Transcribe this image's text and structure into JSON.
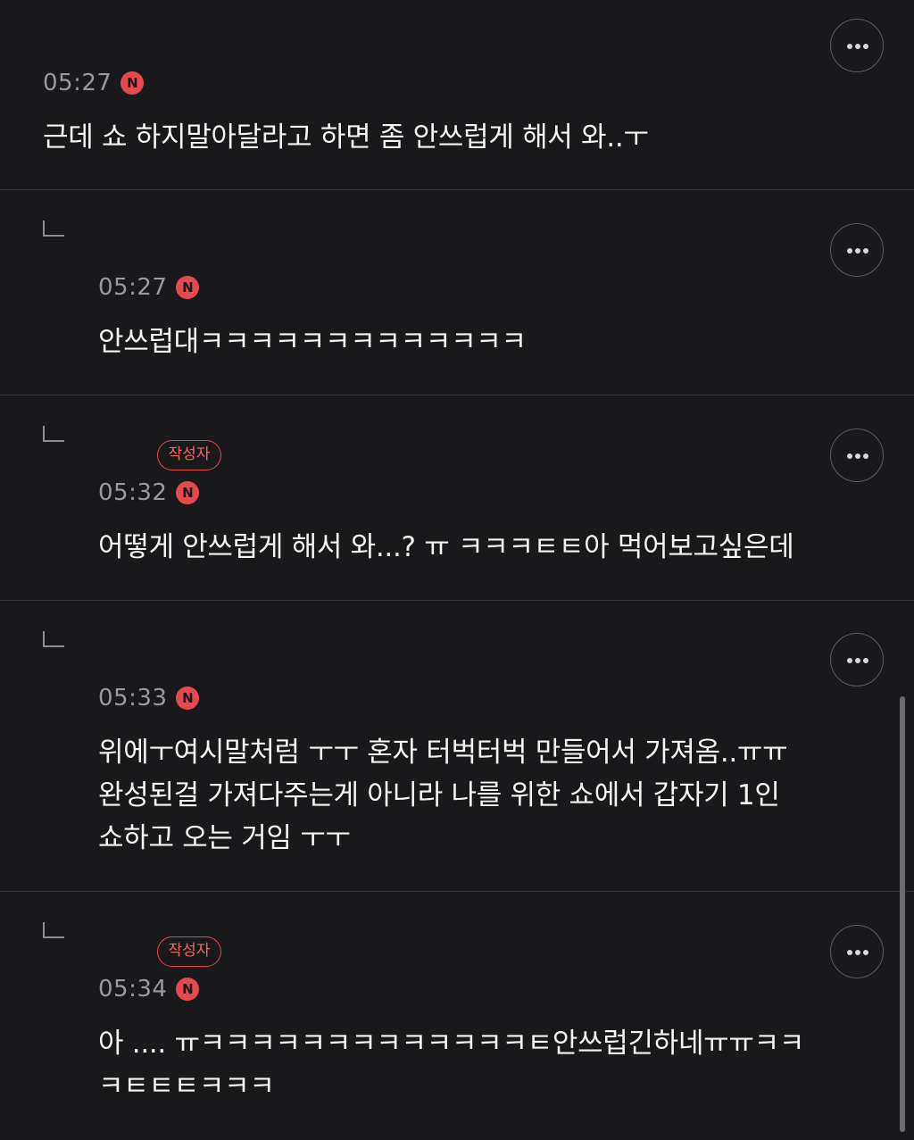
{
  "comments": [
    {
      "time": "05:27",
      "badge": "N",
      "text": "근데 쇼 하지말아달라고 하면 좀 안쓰럽게 해서 와..ㅜ",
      "more_icon": "more-horizontal-icon"
    },
    {
      "reply_icon": "reply-indent-icon",
      "time": "05:27",
      "badge": "N",
      "text": "안쓰럽대ㅋㅋㅋㅋㅋㅋㅋㅋㅋㅋㅋㅋㅋ",
      "more_icon": "more-horizontal-icon"
    },
    {
      "reply_icon": "reply-indent-icon",
      "author_badge": "작성자",
      "time": "05:32",
      "badge": "N",
      "text": "어떻게 안쓰럽게 해서 와...? ㅠ ㅋㅋㅋㅌㅌ아 먹어보고싶은데",
      "more_icon": "more-horizontal-icon"
    },
    {
      "reply_icon": "reply-indent-icon",
      "time": "05:33",
      "badge": "N",
      "text": "위에ㅜ여시말처럼 ㅜㅜ 혼자 터벅터벅 만들어서 가져옴..ㅠㅠ\n완성된걸 가져다주는게 아니라 나를 위한 쇼에서 갑자기 1인\n쇼하고 오는 거임 ㅜㅜ",
      "more_icon": "more-horizontal-icon"
    },
    {
      "reply_icon": "reply-indent-icon",
      "author_badge": "작성자",
      "time": "05:34",
      "badge": "N",
      "text": "아 .... ㅠㅋㅋㅋㅋㅋㅋㅋㅋㅋㅋㅋㅋㅋㅌ안쓰럽긴하네ㅠㅠㅋㅋ\nㅋㅌㅌㅌㅋㅋㅋ",
      "more_icon": "more-horizontal-icon"
    }
  ],
  "colors": {
    "background": "#19191b",
    "accent": "#e5484d",
    "timestamp": "#9a9a9e",
    "divider": "#333336"
  }
}
